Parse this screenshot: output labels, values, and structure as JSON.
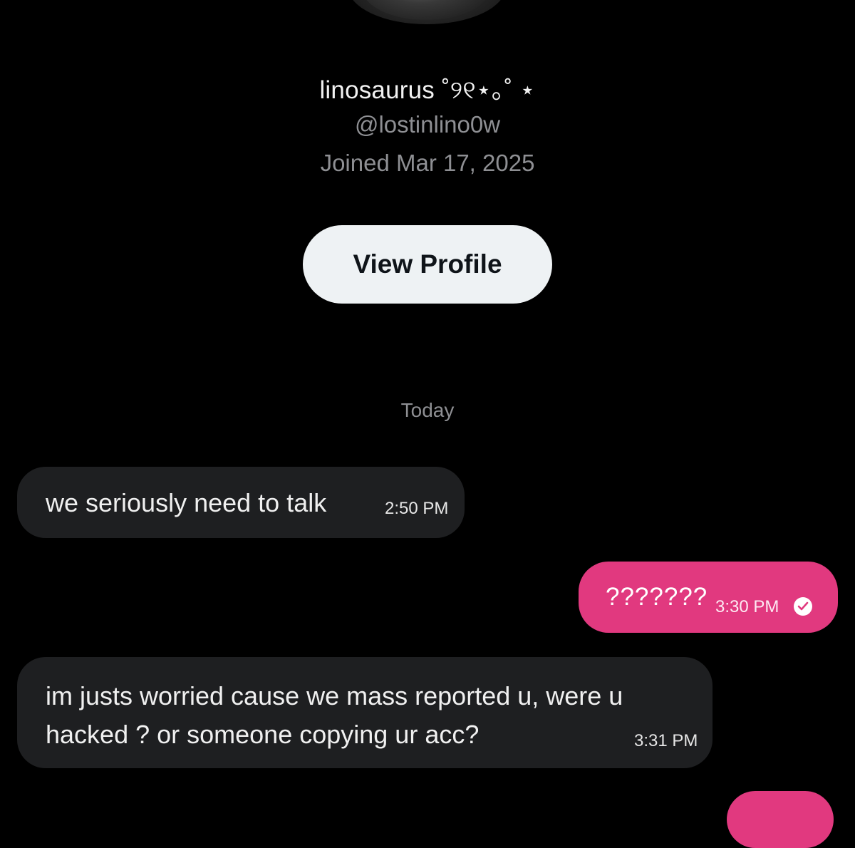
{
  "profile": {
    "display_name": "linosaurus ˚୨୧⋆｡˚ ⋆",
    "handle": "@lostinlino0w",
    "joined": "Joined Mar 17, 2025",
    "view_profile_label": "View Profile"
  },
  "conversation": {
    "date_separator": "Today",
    "messages": [
      {
        "direction": "incoming",
        "text": "we seriously need to talk",
        "time": "2:50 PM"
      },
      {
        "direction": "outgoing",
        "text": "???????",
        "time": "3:30 PM",
        "status_icon": "read-check-icon"
      },
      {
        "direction": "incoming",
        "text": "im justs worried cause we mass reported u, were u hacked ? or someone copying ur acc?",
        "time": "3:31 PM"
      },
      {
        "direction": "outgoing",
        "text": "",
        "time": ""
      }
    ]
  },
  "colors": {
    "background": "#000000",
    "incoming_bubble": "#1e1f21",
    "outgoing_bubble": "#e1397f",
    "secondary_text": "#8e8f93",
    "profile_button": "#eef2f4"
  }
}
